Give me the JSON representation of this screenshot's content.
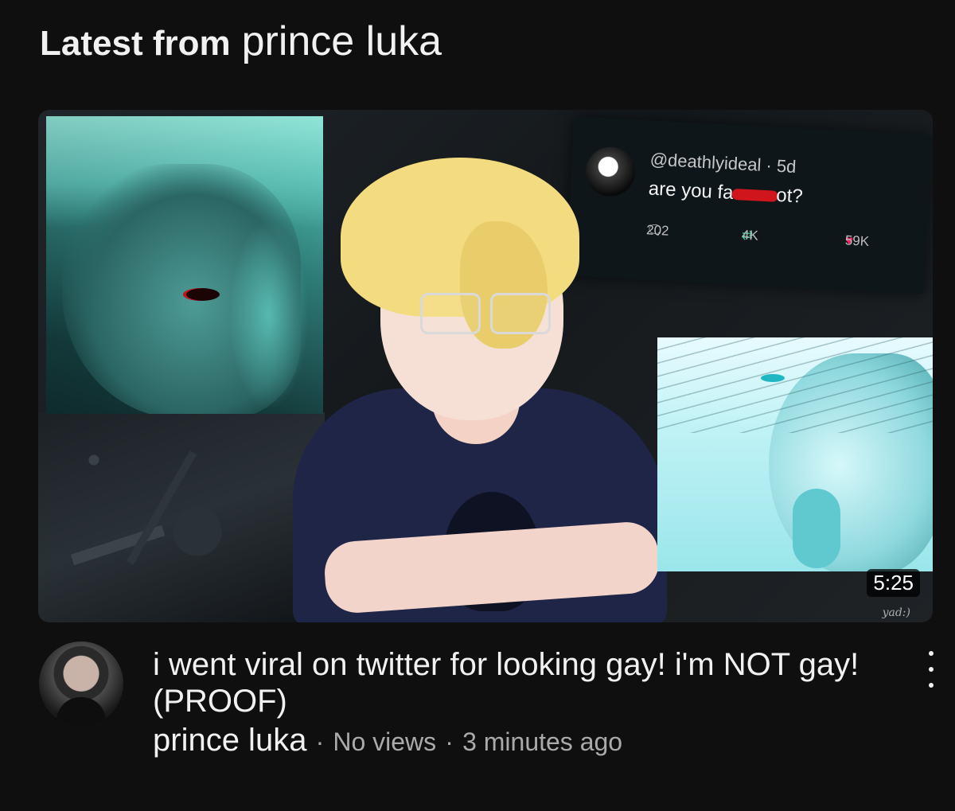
{
  "section": {
    "prefix": "Latest from",
    "channel_name": "prince luka"
  },
  "thumbnail": {
    "duration": "5:25",
    "signature": "yad:)",
    "tweet": {
      "handle": "@deathlyideal · 5d",
      "text_start": "are you fa",
      "text_end": "ot?",
      "replies": "202",
      "retweets": "4K",
      "likes": "59K",
      "icons": [
        "reply-icon",
        "retweet-icon",
        "heart-icon"
      ]
    }
  },
  "video": {
    "title": "i went viral on twitter for looking gay! i'm NOT gay! (PROOF)",
    "channel": "prince luka",
    "views": "No views",
    "age": "3 minutes ago",
    "separator": "·"
  },
  "menu_icon": "more-vertical-icon",
  "colors": {
    "background": "#0f0f0f",
    "primary_text": "#f1f1f1",
    "secondary_text": "#aaaaaa",
    "like": "#f0245e",
    "retweet": "#2ec08a"
  }
}
